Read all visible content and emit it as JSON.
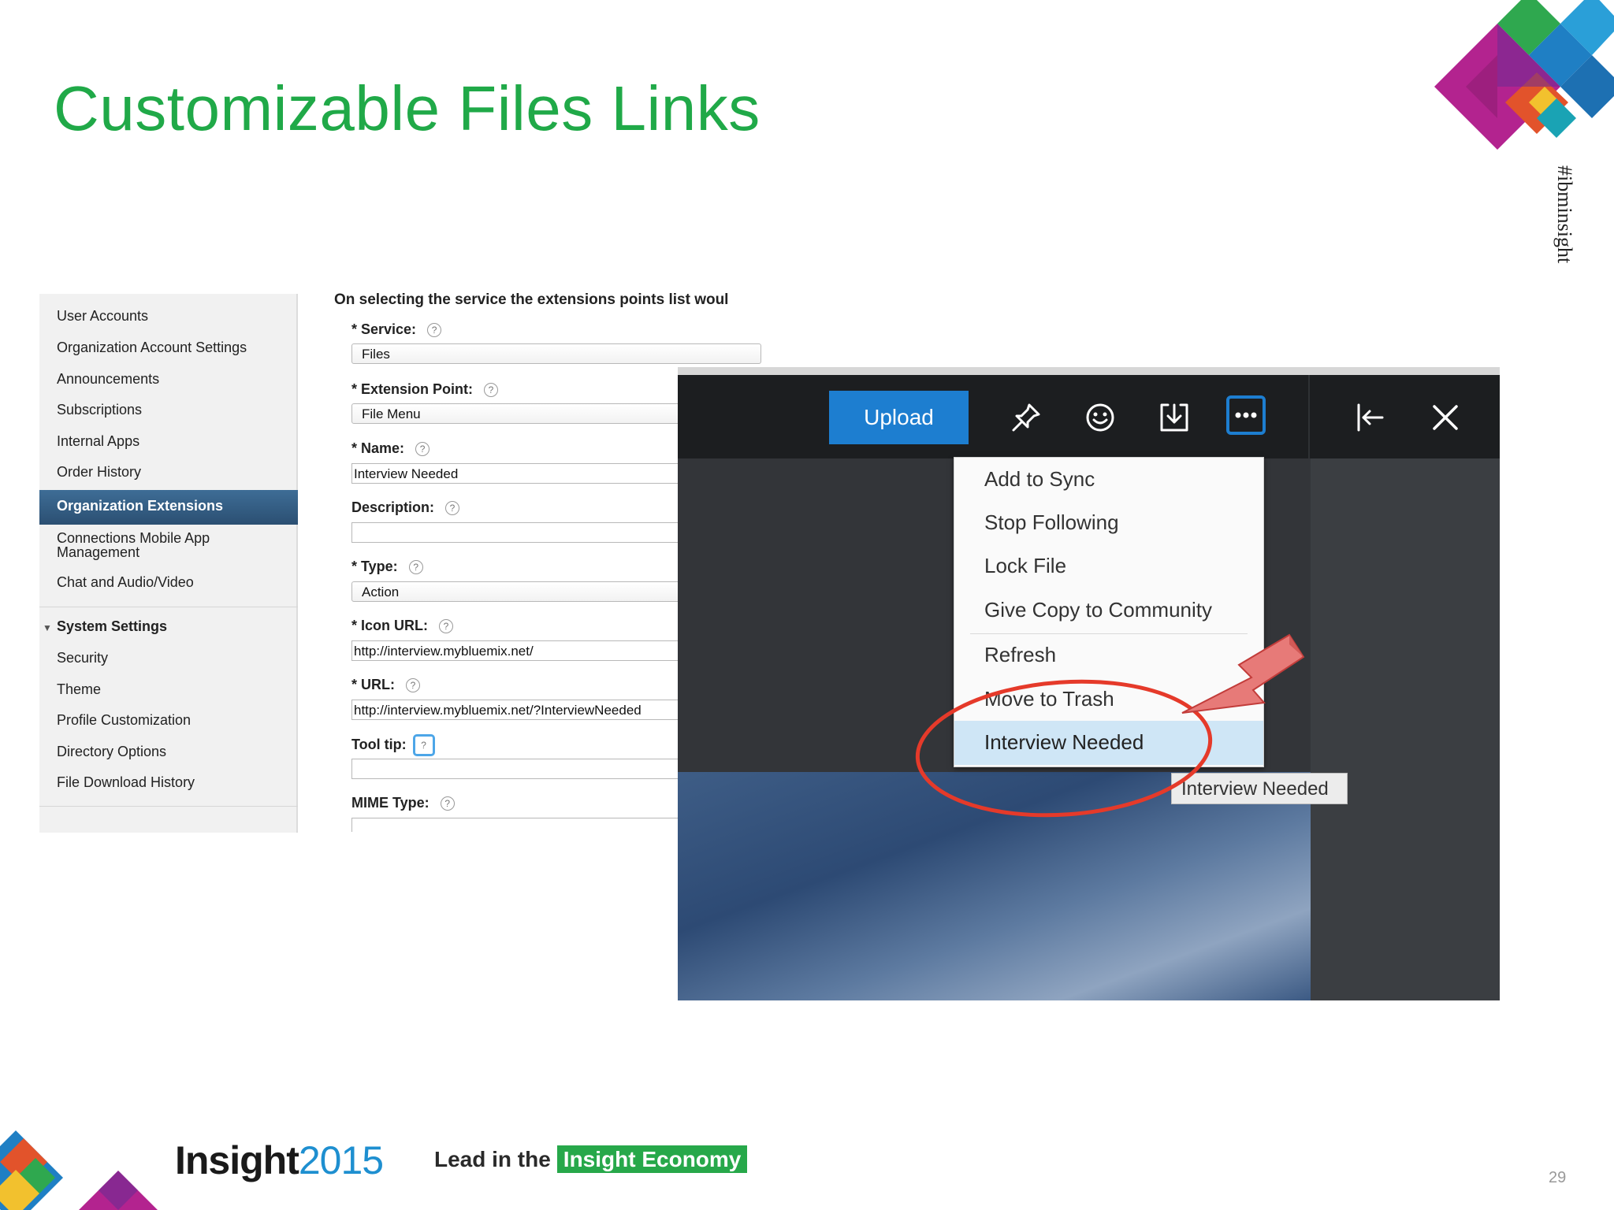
{
  "slide": {
    "title": "Customizable Files Links",
    "hashtag": "#ibminsight",
    "page_number": "29"
  },
  "sidebar": {
    "items": [
      {
        "label": "User Accounts"
      },
      {
        "label": "Organization Account Settings"
      },
      {
        "label": "Announcements"
      },
      {
        "label": "Subscriptions"
      },
      {
        "label": "Internal Apps"
      },
      {
        "label": "Order History"
      },
      {
        "label": "Organization Extensions",
        "active": true
      },
      {
        "label": "Connections Mobile App"
      },
      {
        "label": "Management"
      },
      {
        "label": "Chat and Audio/Video"
      }
    ],
    "system_settings": {
      "label": "System Settings",
      "items": [
        {
          "label": "Security"
        },
        {
          "label": "Theme"
        },
        {
          "label": "Profile Customization"
        },
        {
          "label": "Directory Options"
        },
        {
          "label": "File Download History"
        }
      ]
    }
  },
  "form": {
    "heading": "On selecting the service the extensions points list woul",
    "service": {
      "label": "* Service:",
      "value": "Files"
    },
    "extension_point": {
      "label": "* Extension Point:",
      "value": "File Menu"
    },
    "name": {
      "label": "* Name:",
      "value": "Interview Needed"
    },
    "description": {
      "label": "Description:",
      "value": ""
    },
    "type": {
      "label": "* Type:",
      "value": "Action"
    },
    "icon_url": {
      "label": "*  Icon URL:",
      "value": "http://interview.mybluemix.net/"
    },
    "url": {
      "label": "* URL:",
      "value": "http://interview.mybluemix.net/?InterviewNeeded"
    },
    "tooltip": {
      "label": "Tool tip:",
      "value": ""
    },
    "mime_type": {
      "label": "MIME Type:",
      "value": ""
    },
    "help_glyph": "?"
  },
  "viewer": {
    "upload_label": "Upload",
    "menu_items": [
      {
        "label": "Add to Sync"
      },
      {
        "label": "Stop Following"
      },
      {
        "label": "Lock File"
      },
      {
        "label": "Give Copy to Community"
      },
      {
        "label": "Refresh"
      },
      {
        "label": "Move to Trash"
      },
      {
        "label": "Interview Needed",
        "highlighted": true
      }
    ],
    "tooltip_text": "Interview Needed",
    "icons": [
      "pin-icon",
      "smiley-icon",
      "download-icon",
      "more-icon",
      "collapse-panel-icon",
      "close-icon"
    ],
    "accent_color": "#1d7ed0",
    "annotation_color": "#e53a2a"
  },
  "footer": {
    "logo_word": "Insight",
    "logo_year": "2015",
    "tagline_prefix": "Lead in the",
    "tagline_highlight": "Insight Economy"
  },
  "colors": {
    "title_green": "#20a948",
    "sidebar_active": "#2b4f72"
  }
}
